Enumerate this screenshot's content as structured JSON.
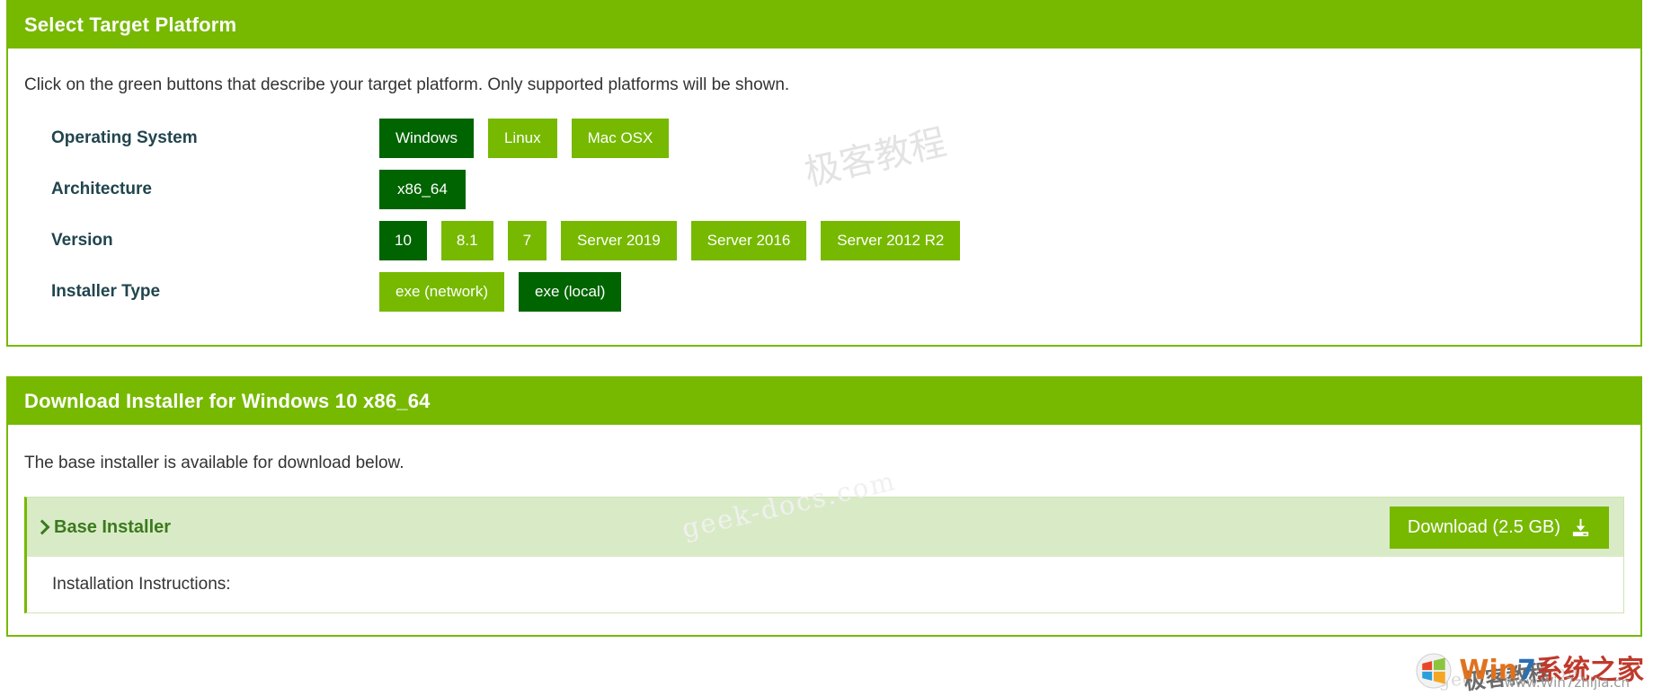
{
  "select_panel": {
    "header": "Select Target Platform",
    "intro": "Click on the green buttons that describe your target platform. Only supported platforms will be shown.",
    "rows": [
      {
        "label": "Operating System",
        "options": [
          {
            "label": "Windows",
            "selected": true
          },
          {
            "label": "Linux",
            "selected": false
          },
          {
            "label": "Mac OSX",
            "selected": false
          }
        ]
      },
      {
        "label": "Architecture",
        "options": [
          {
            "label": "x86_64",
            "selected": true
          }
        ]
      },
      {
        "label": "Version",
        "options": [
          {
            "label": "10",
            "selected": true
          },
          {
            "label": "8.1",
            "selected": false
          },
          {
            "label": "7",
            "selected": false
          },
          {
            "label": "Server 2019",
            "selected": false
          },
          {
            "label": "Server 2016",
            "selected": false
          },
          {
            "label": "Server 2012 R2",
            "selected": false
          }
        ]
      },
      {
        "label": "Installer Type",
        "options": [
          {
            "label": "exe (network)",
            "selected": false
          },
          {
            "label": "exe (local)",
            "selected": true
          }
        ]
      }
    ]
  },
  "download_panel": {
    "header": "Download Installer for Windows 10 x86_64",
    "intro": "The base installer is available for download below.",
    "installer": {
      "title": "Base Installer",
      "download_label": "Download (2.5 GB)",
      "download_icon": "download-icon",
      "instructions_label": "Installation Instructions:"
    }
  },
  "watermarks": {
    "chinese": "极客教程",
    "docs": "geek-docs.com",
    "docs_small": "geek-docs.com",
    "chinese_small": "极客教程",
    "logo": {
      "win": "Win",
      "seven": "7",
      "chinese": "系统之家",
      "url": "www.Win7zhijia.cn"
    }
  },
  "colors": {
    "brand_green": "#76b900",
    "selected_green": "#006400",
    "label_text": "#21454e",
    "installer_bar_bg": "#d9ebc6"
  }
}
